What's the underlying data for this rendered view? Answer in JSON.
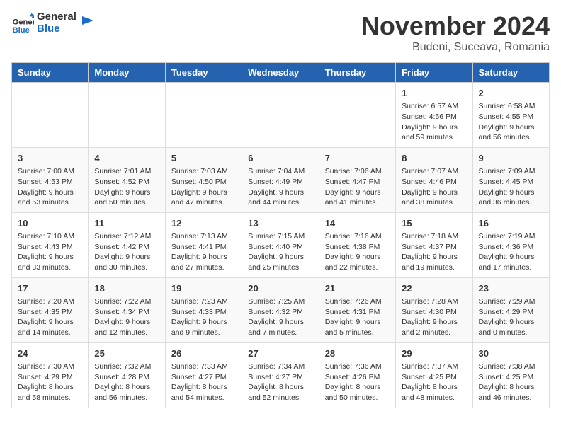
{
  "logo": {
    "line1": "General",
    "line2": "Blue"
  },
  "title": "November 2024",
  "subtitle": "Budeni, Suceava, Romania",
  "weekdays": [
    "Sunday",
    "Monday",
    "Tuesday",
    "Wednesday",
    "Thursday",
    "Friday",
    "Saturday"
  ],
  "weeks": [
    [
      {
        "day": "",
        "info": ""
      },
      {
        "day": "",
        "info": ""
      },
      {
        "day": "",
        "info": ""
      },
      {
        "day": "",
        "info": ""
      },
      {
        "day": "",
        "info": ""
      },
      {
        "day": "1",
        "info": "Sunrise: 6:57 AM\nSunset: 4:56 PM\nDaylight: 9 hours and 59 minutes."
      },
      {
        "day": "2",
        "info": "Sunrise: 6:58 AM\nSunset: 4:55 PM\nDaylight: 9 hours and 56 minutes."
      }
    ],
    [
      {
        "day": "3",
        "info": "Sunrise: 7:00 AM\nSunset: 4:53 PM\nDaylight: 9 hours and 53 minutes."
      },
      {
        "day": "4",
        "info": "Sunrise: 7:01 AM\nSunset: 4:52 PM\nDaylight: 9 hours and 50 minutes."
      },
      {
        "day": "5",
        "info": "Sunrise: 7:03 AM\nSunset: 4:50 PM\nDaylight: 9 hours and 47 minutes."
      },
      {
        "day": "6",
        "info": "Sunrise: 7:04 AM\nSunset: 4:49 PM\nDaylight: 9 hours and 44 minutes."
      },
      {
        "day": "7",
        "info": "Sunrise: 7:06 AM\nSunset: 4:47 PM\nDaylight: 9 hours and 41 minutes."
      },
      {
        "day": "8",
        "info": "Sunrise: 7:07 AM\nSunset: 4:46 PM\nDaylight: 9 hours and 38 minutes."
      },
      {
        "day": "9",
        "info": "Sunrise: 7:09 AM\nSunset: 4:45 PM\nDaylight: 9 hours and 36 minutes."
      }
    ],
    [
      {
        "day": "10",
        "info": "Sunrise: 7:10 AM\nSunset: 4:43 PM\nDaylight: 9 hours and 33 minutes."
      },
      {
        "day": "11",
        "info": "Sunrise: 7:12 AM\nSunset: 4:42 PM\nDaylight: 9 hours and 30 minutes."
      },
      {
        "day": "12",
        "info": "Sunrise: 7:13 AM\nSunset: 4:41 PM\nDaylight: 9 hours and 27 minutes."
      },
      {
        "day": "13",
        "info": "Sunrise: 7:15 AM\nSunset: 4:40 PM\nDaylight: 9 hours and 25 minutes."
      },
      {
        "day": "14",
        "info": "Sunrise: 7:16 AM\nSunset: 4:38 PM\nDaylight: 9 hours and 22 minutes."
      },
      {
        "day": "15",
        "info": "Sunrise: 7:18 AM\nSunset: 4:37 PM\nDaylight: 9 hours and 19 minutes."
      },
      {
        "day": "16",
        "info": "Sunrise: 7:19 AM\nSunset: 4:36 PM\nDaylight: 9 hours and 17 minutes."
      }
    ],
    [
      {
        "day": "17",
        "info": "Sunrise: 7:20 AM\nSunset: 4:35 PM\nDaylight: 9 hours and 14 minutes."
      },
      {
        "day": "18",
        "info": "Sunrise: 7:22 AM\nSunset: 4:34 PM\nDaylight: 9 hours and 12 minutes."
      },
      {
        "day": "19",
        "info": "Sunrise: 7:23 AM\nSunset: 4:33 PM\nDaylight: 9 hours and 9 minutes."
      },
      {
        "day": "20",
        "info": "Sunrise: 7:25 AM\nSunset: 4:32 PM\nDaylight: 9 hours and 7 minutes."
      },
      {
        "day": "21",
        "info": "Sunrise: 7:26 AM\nSunset: 4:31 PM\nDaylight: 9 hours and 5 minutes."
      },
      {
        "day": "22",
        "info": "Sunrise: 7:28 AM\nSunset: 4:30 PM\nDaylight: 9 hours and 2 minutes."
      },
      {
        "day": "23",
        "info": "Sunrise: 7:29 AM\nSunset: 4:29 PM\nDaylight: 9 hours and 0 minutes."
      }
    ],
    [
      {
        "day": "24",
        "info": "Sunrise: 7:30 AM\nSunset: 4:29 PM\nDaylight: 8 hours and 58 minutes."
      },
      {
        "day": "25",
        "info": "Sunrise: 7:32 AM\nSunset: 4:28 PM\nDaylight: 8 hours and 56 minutes."
      },
      {
        "day": "26",
        "info": "Sunrise: 7:33 AM\nSunset: 4:27 PM\nDaylight: 8 hours and 54 minutes."
      },
      {
        "day": "27",
        "info": "Sunrise: 7:34 AM\nSunset: 4:27 PM\nDaylight: 8 hours and 52 minutes."
      },
      {
        "day": "28",
        "info": "Sunrise: 7:36 AM\nSunset: 4:26 PM\nDaylight: 8 hours and 50 minutes."
      },
      {
        "day": "29",
        "info": "Sunrise: 7:37 AM\nSunset: 4:25 PM\nDaylight: 8 hours and 48 minutes."
      },
      {
        "day": "30",
        "info": "Sunrise: 7:38 AM\nSunset: 4:25 PM\nDaylight: 8 hours and 46 minutes."
      }
    ]
  ]
}
